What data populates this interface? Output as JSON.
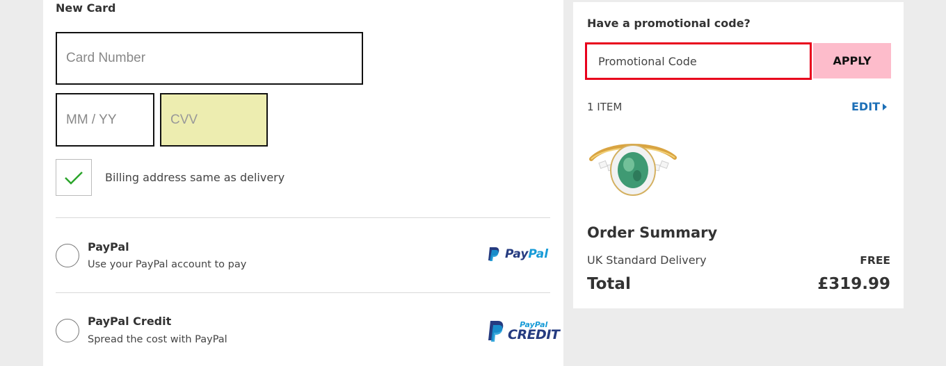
{
  "payment": {
    "section_title": "New Card",
    "card_number_placeholder": "Card Number",
    "expiry_placeholder": "MM / YY",
    "cvv_placeholder": "CVV",
    "billing_same_label": "Billing address same as delivery",
    "billing_same_checked": true,
    "options": [
      {
        "title": "PayPal",
        "subtitle": "Use your PayPal account to pay",
        "logo": "paypal-logo"
      },
      {
        "title": "PayPal Credit",
        "subtitle": "Spread the cost with PayPal",
        "logo": "paypal-credit-logo"
      }
    ],
    "paypal_logo": {
      "pay": "Pay",
      "pal": "Pal"
    },
    "credit_logo": {
      "small": "PayPal",
      "big": "CREDIT"
    }
  },
  "promo": {
    "heading": "Have a promotional code?",
    "input_placeholder": "Promotional Code",
    "apply_label": "APPLY"
  },
  "cart": {
    "item_count": "1 ITEM",
    "edit_label": "EDIT"
  },
  "summary": {
    "title": "Order Summary",
    "delivery_label": "UK Standard Delivery",
    "delivery_value": "FREE",
    "total_label": "Total",
    "total_value": "£319.99"
  },
  "colors": {
    "accent_link": "#1c6fb7",
    "apply_button": "#fdbccb",
    "promo_focus_border": "#e8001c",
    "cvv_autofill": "#ededb0",
    "check_green": "#2ba52b"
  }
}
